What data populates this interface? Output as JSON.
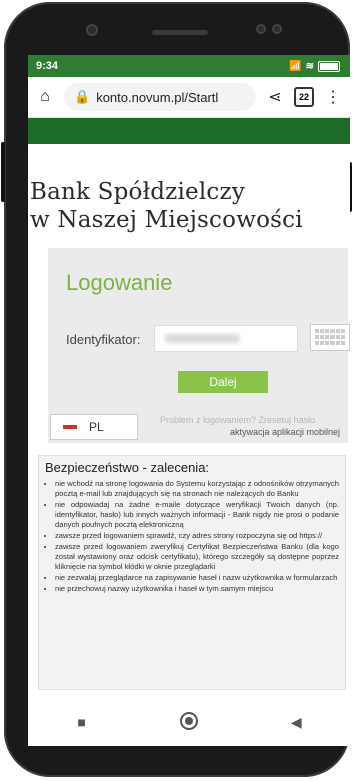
{
  "status": {
    "time": "9:34",
    "signal": "📶",
    "wifi": "≋"
  },
  "browser": {
    "url": "konto.novum.pl/Startl",
    "tab_count": "22",
    "icons": {
      "home": "home-icon",
      "lock": "lock-icon",
      "share": "share-icon",
      "menu": "more-vertical-icon"
    }
  },
  "page": {
    "bank_line1": "Bank Spółdzielczy",
    "bank_line2": "w Naszej Miejscowości",
    "login": {
      "title": "Logowanie",
      "id_label": "Identyfikator:",
      "submit_label": "Dalej",
      "lang_label": "PL",
      "problem_link": "Problem z logowaniem? Zresetuj hasło",
      "activation_link": "aktywacja aplikacji mobilnej"
    },
    "security": {
      "title": "Bezpieczeństwo - zalecenia:",
      "items": [
        "nie wchodź na stronę logowania do Systemu korzystając z odnośników otrzymanych pocztą e-mail lub znajdujących się na stronach nie należących do Banku",
        "nie odpowiadaj na żadne e-maile dotyczące weryfikacji Twoich danych (np. identyfikator, hasło) lub innych ważnych informacji - Bank nigdy nie prosi o podanie danych poufnych pocztą elektroniczną",
        "zawsze przed logowaniem sprawdź, czy adres strony rozpoczyna się od https://",
        "zawsze przed logowaniem zweryfikuj Certyfikat Bezpieczeństwa Banku (dla kogo został wystawiony oraz odcisk certyfikatu), którego szczegóły są dostępne poprzez kliknięcie na symbol kłódki w oknie przeglądarki",
        "nie zezwalaj przeglądarce na zapisywanie haseł i nazw użytkownika w formularzach",
        "nie przechowuj nazwy użytkownika i haseł w tym samym miejscu"
      ]
    }
  },
  "navbar": {
    "back": "◀",
    "home": "home-circle-icon",
    "recents": "■"
  },
  "colors": {
    "status_green": "#2e7d32",
    "brand_green": "#1f6b2a",
    "accent": "#8bc34a"
  }
}
